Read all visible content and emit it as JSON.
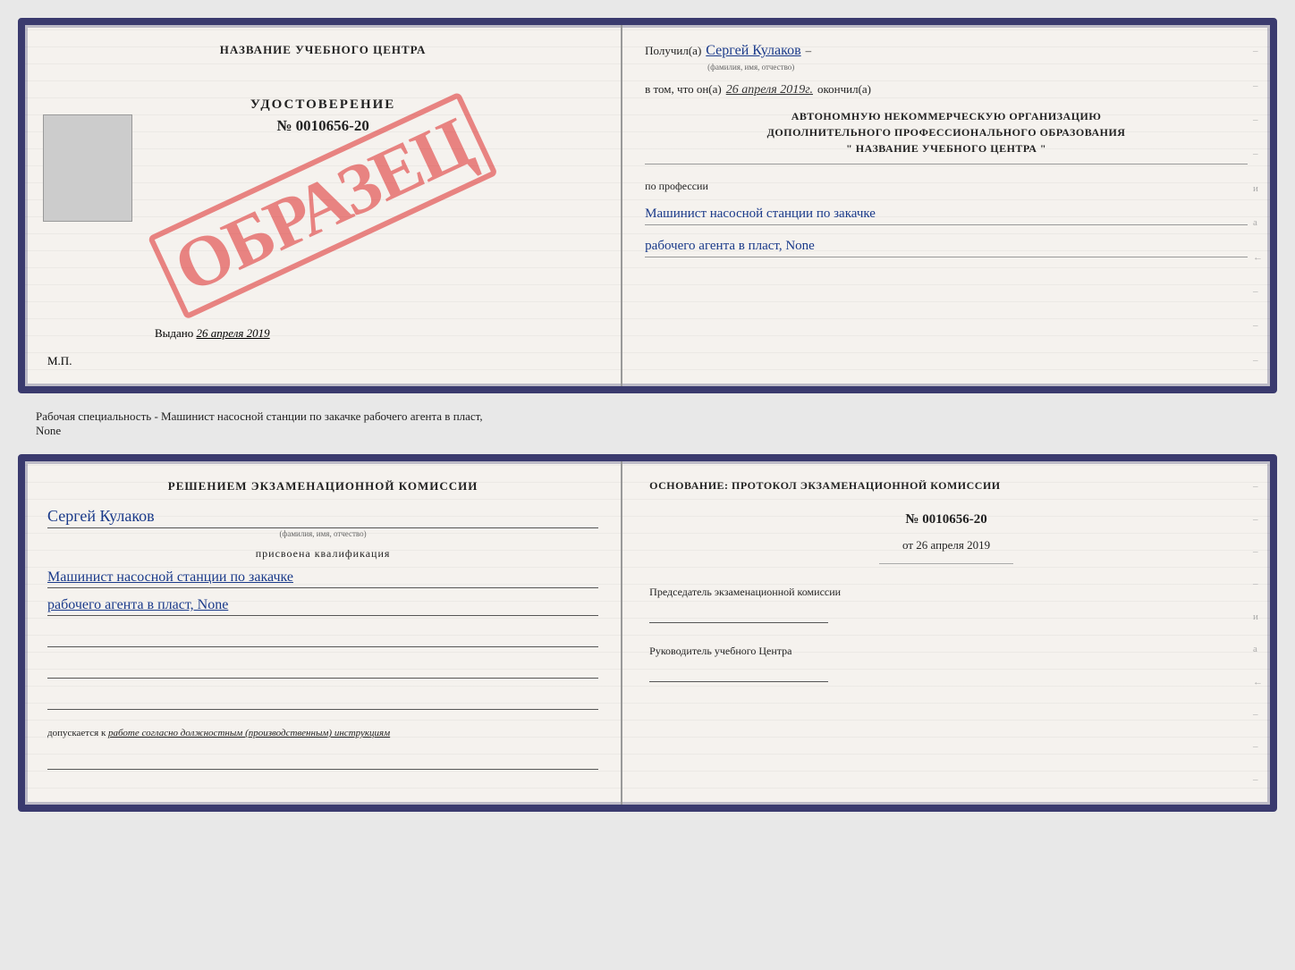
{
  "top": {
    "left": {
      "title": "НАЗВАНИЕ УЧЕБНОГО ЦЕНТРА",
      "udostoverenie_label": "УДОСТОВЕРЕНИЕ",
      "number": "№ 0010656-20",
      "vydano_label": "Выдано",
      "vydano_date": "26 апреля 2019",
      "mp_label": "М.П.",
      "obrazets": "ОБРАЗЕЦ"
    },
    "right": {
      "poluchil_label": "Получил(а)",
      "recipient_name": "Сергей Кулаков",
      "fio_hint": "(фамилия, имя, отчество)",
      "vtom_label": "в том, что он(а)",
      "date_value": "26 апреля 2019г.",
      "okonchil_label": "окончил(а)",
      "org_line1": "АВТОНОМНУЮ НЕКОММЕРЧЕСКУЮ ОРГАНИЗАЦИЮ",
      "org_line2": "ДОПОЛНИТЕЛЬНОГО ПРОФЕССИОНАЛЬНОГО ОБРАЗОВАНИЯ",
      "org_quote": "\"  НАЗВАНИЕ УЧЕБНОГО ЦЕНТРА  \"",
      "po_professii": "по профессии",
      "profession_line1": "Машинист насосной станции по закачке",
      "profession_line2": "рабочего агента в пласт, None"
    }
  },
  "middle_text": "Рабочая специальность - Машинист насосной станции по закачке рабочего агента в пласт,\nNone",
  "bottom": {
    "left": {
      "komissia_title": "Решением экзаменационной комиссии",
      "name": "Сергей Кулаков",
      "fio_hint": "(фамилия, имя, отчество)",
      "prisvoena": "присвоена квалификация",
      "kvalif_line1": "Машинист насосной станции по закачке",
      "kvalif_line2": "рабочего агента в пласт, None",
      "dopuskaetsya_prefix": "допускается к",
      "dopuskaetsya_text": "работе согласно должностным (производственным) инструкциям"
    },
    "right": {
      "osnov_label": "Основание: протокол экзаменационной комиссии",
      "number": "№ 0010656-20",
      "ot_label": "от",
      "date": "26 апреля 2019",
      "chairman_title": "Председатель экзаменационной комиссии",
      "rukovod_title": "Руководитель учебного Центра"
    }
  },
  "dashes": [
    "-",
    "-",
    "-",
    "-",
    "и",
    "а",
    "←",
    "-",
    "-",
    "-"
  ]
}
